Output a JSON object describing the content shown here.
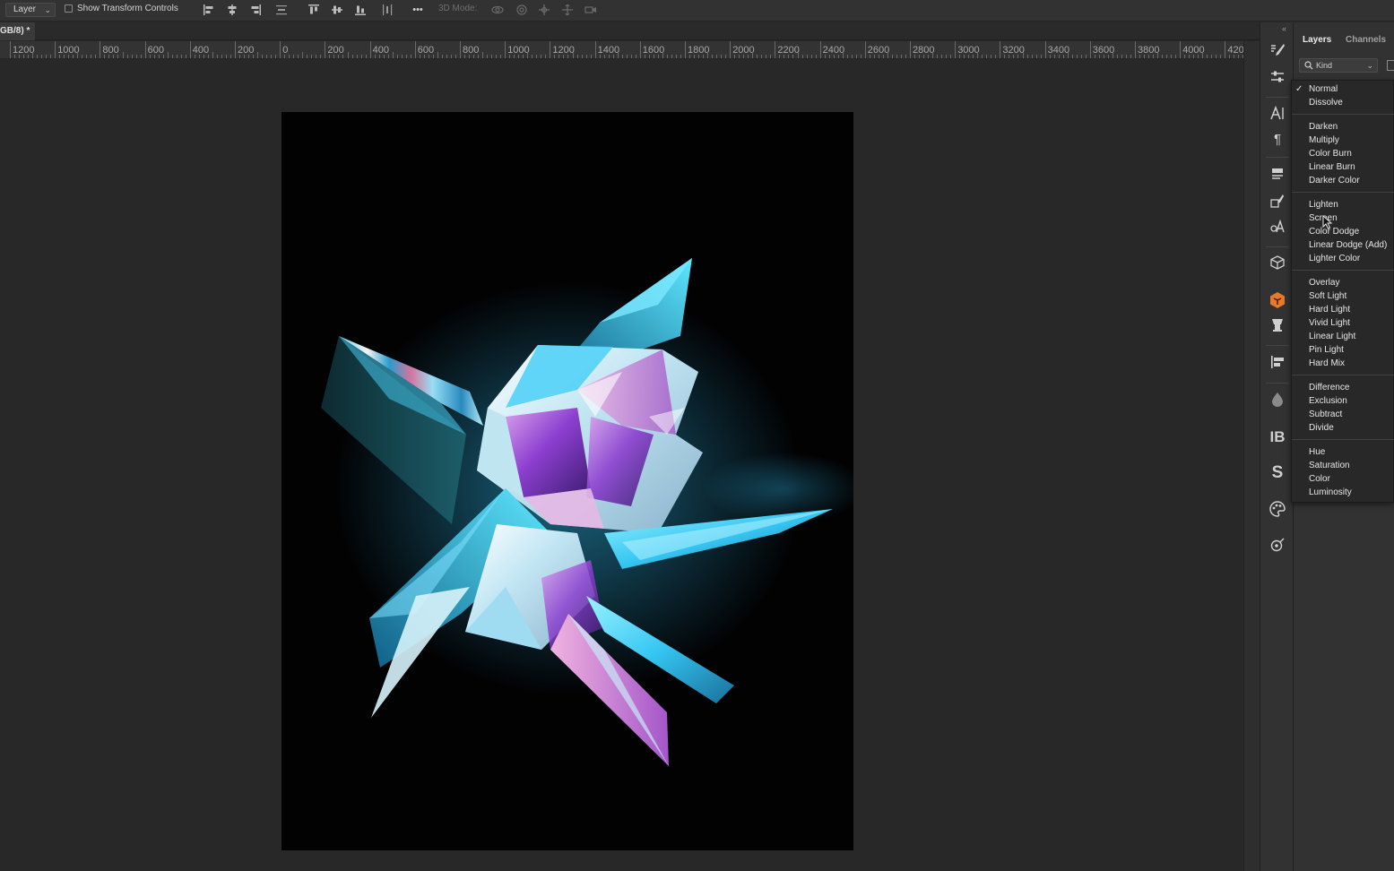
{
  "options_bar": {
    "auto_select_target": "Layer",
    "show_transform_label": "Show Transform Controls",
    "more_label": "•••",
    "threed_mode_label": "3D Mode:"
  },
  "document": {
    "tab_title": "GB/8) *"
  },
  "ruler": {
    "labels": [
      "1200",
      "1000",
      "800",
      "600",
      "400",
      "200",
      "0",
      "200",
      "400",
      "600",
      "800",
      "1000",
      "1200",
      "1400",
      "1600",
      "1800",
      "2000",
      "2200",
      "2400",
      "2600",
      "2800",
      "3000",
      "3200",
      "3400",
      "3600",
      "3800",
      "4000",
      "420"
    ]
  },
  "icons": {
    "dock": [
      "brush-settings-icon",
      "adjustments-icon",
      "character-icon",
      "paragraph-icon",
      "glyphs-icon",
      "brush-preset-icon",
      "character-styles-icon",
      "3d-cube-icon",
      "orange-plugin-icon",
      "clone-source-icon",
      "align-icon",
      "droplet-icon",
      "ib-plugin-icon",
      "s-plugin-icon",
      "palette-icon",
      "navigator-icon"
    ]
  },
  "layers_panel": {
    "tabs": [
      "Layers",
      "Channels"
    ],
    "filter_label": "Kind"
  },
  "blend_modes": {
    "selected": "Normal",
    "hovered": "Screen",
    "groups": [
      [
        "Normal",
        "Dissolve"
      ],
      [
        "Darken",
        "Multiply",
        "Color Burn",
        "Linear Burn",
        "Darker Color"
      ],
      [
        "Lighten",
        "Screen",
        "Color Dodge",
        "Linear Dodge (Add)",
        "Lighter Color"
      ],
      [
        "Overlay",
        "Soft Light",
        "Hard Light",
        "Vivid Light",
        "Linear Light",
        "Pin Light",
        "Hard Mix"
      ],
      [
        "Difference",
        "Exclusion",
        "Subtract",
        "Divide"
      ],
      [
        "Hue",
        "Saturation",
        "Color",
        "Luminosity"
      ]
    ]
  },
  "colors": {
    "crystal_cyan": "#3fd8ff",
    "crystal_violet": "#9b4fd6",
    "crystal_pink": "#e07ac8",
    "accent_orange": "#e8782a"
  }
}
